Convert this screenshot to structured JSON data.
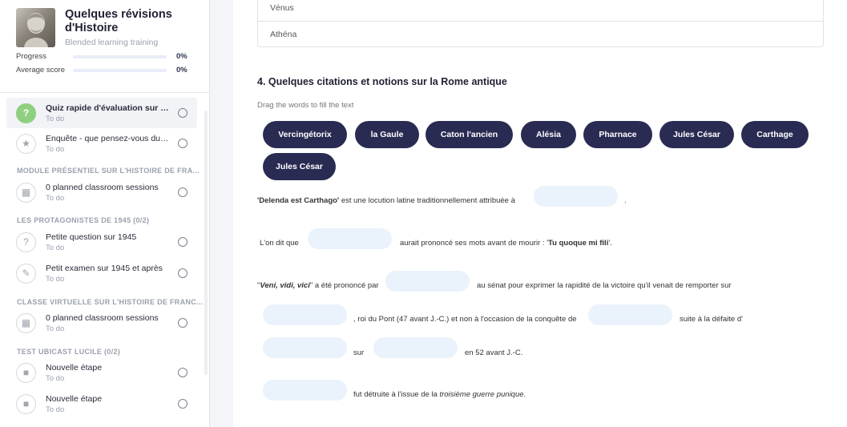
{
  "sidebar": {
    "course_title": "Quelques révisions d'Histoire",
    "course_subtitle": "Blended learning training",
    "progress_label": "Progress",
    "progress_value": "0%",
    "progress_fraction": 0,
    "score_label": "Average score",
    "score_value": "0%",
    "score_fraction": 0,
    "items": [
      {
        "title": "Quiz rapide d'évaluation sur l'...",
        "status": "To do",
        "icon": "question-icon"
      },
      {
        "title": "Enquête - que pensez-vous du 1...",
        "status": "To do",
        "icon": "star-icon"
      },
      {
        "title": "0 planned classroom sessions",
        "status": "To do",
        "icon": "calendar-icon"
      },
      {
        "title": "Petite question sur 1945",
        "status": "To do",
        "icon": "question-icon"
      },
      {
        "title": "Petit examen sur 1945 et après",
        "status": "To do",
        "icon": "pencil-icon"
      },
      {
        "title": "0 planned classroom sessions",
        "status": "To do",
        "icon": "calendar-icon"
      },
      {
        "title": "Nouvelle étape",
        "status": "To do",
        "icon": "video-icon"
      },
      {
        "title": "Nouvelle étape",
        "status": "To do",
        "icon": "video-icon"
      }
    ],
    "sections": [
      "MODULE PRÉSENTIEL SUR L'HISTOIRE DE FRA...",
      "LES PROTAGONISTES DE 1945  (0/2)",
      "CLASSE VIRTUELLE SUR L'HISTOIRE DE FRANC...",
      "TEST UBICAST LUCILE  (0/2)"
    ]
  },
  "main": {
    "options": [
      "Vénus",
      "Athéna"
    ],
    "question_number": "4.",
    "question_title": "Quelques citations et notions sur la Rome antique",
    "instruction": "Drag the words to fill the text",
    "words": [
      "Vercingétorix",
      "la Gaule",
      "Caton l'ancien",
      "Alésia",
      "Pharnace",
      "Jules César",
      "Carthage",
      "Jules César"
    ],
    "sentences": {
      "s1_quote": "'Delenda est Carthago'",
      "s1_rest": " est une locution latine traditionnellement attribuée à",
      "s1_end": ".",
      "s2_start": "L'on dit que",
      "s2_mid": "aurait prononcé ses mots avant de mourir : '",
      "s2_quote": "Tu quoque mi fili",
      "s2_end": "'.",
      "s3_q1": "Veni, vidi, vici",
      "s3_rest": "\" a été prononcé par",
      "s3_mid": "au sénat pour exprimer la rapidité de la victoire qu'il venait de remporter sur",
      "s4_mid": ", roi du Pont (47 avant J.-C.) et non à l'occasion de la conquête de",
      "s4_end": "suite à la défaite d'",
      "s5_mid": "sur",
      "s5_end": "en 52 avant J.-C.",
      "s6_start": "fut détruite à l'issue de la ",
      "s6_em": "troisième guerre punique",
      "s6_end": "."
    }
  }
}
